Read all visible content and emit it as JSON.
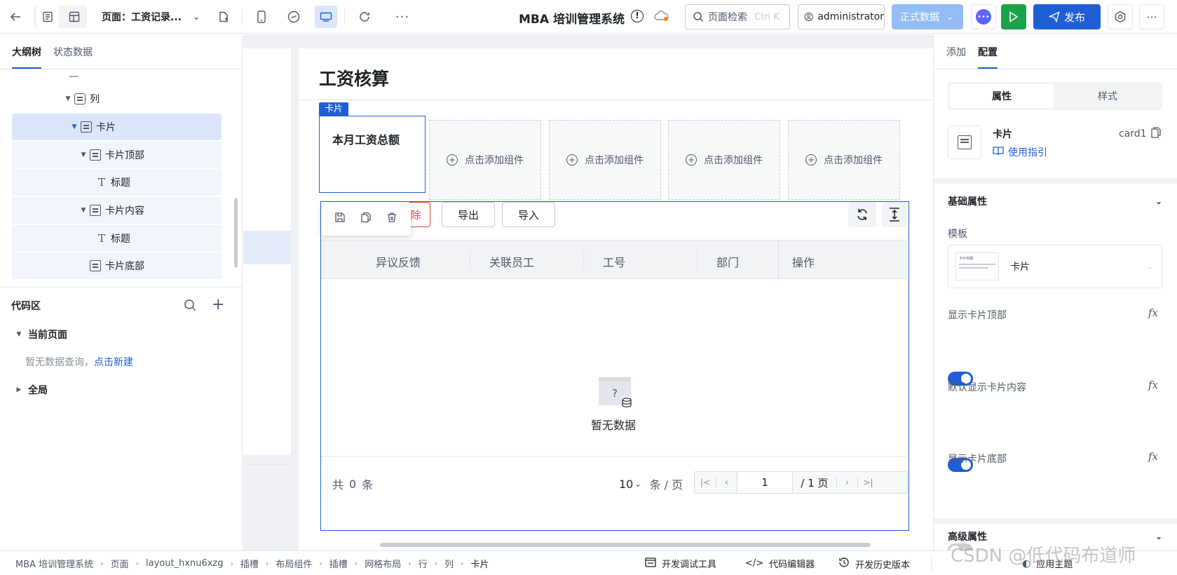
{
  "topbar": {
    "page_label": "页面：工资记录...",
    "app_title": "MBA 培训管理系统",
    "search_placeholder": "页面检索",
    "search_shortcut": "Ctrl K",
    "user": "administrator",
    "env_label": "正式数据",
    "publish_label": "发布"
  },
  "left": {
    "tabs": [
      "大纲树",
      "状态数据"
    ],
    "tree": {
      "dash": "—",
      "col": "列",
      "card": "卡片",
      "card_top": "卡片顶部",
      "title1": "标题",
      "card_content": "卡片内容",
      "title2": "标题",
      "card_bottom": "卡片底部"
    },
    "code": {
      "header": "代码区",
      "current_page": "当前页面",
      "empty_prefix": "暂无数据查询，",
      "empty_link": "点击新建",
      "global": "全局"
    }
  },
  "canvas": {
    "page_title": "工资核算",
    "card_tag": "卡片",
    "card_title": "本月工资总额",
    "add_slot_label": "点击添加组件",
    "toolbar": {
      "delete_partial": "除",
      "export": "导出",
      "import": "导入"
    },
    "table": {
      "columns": [
        "异议反馈",
        "关联员工",
        "工号",
        "部门",
        "操作"
      ],
      "empty_text": "暂无数据",
      "empty_icon_glyph": "?"
    },
    "pagination": {
      "total_prefix": "共",
      "total_count": "0",
      "total_suffix": "条",
      "page_size": "10",
      "per_page": "条 / 页",
      "current_page": "1",
      "total_pages": "/ 1 页"
    }
  },
  "right": {
    "tabs": [
      "添加",
      "配置"
    ],
    "segment": [
      "属性",
      "样式"
    ],
    "component_name": "卡片",
    "component_id": "card1",
    "guide_link": "使用指引",
    "basic_props": "基础属性",
    "template_label": "模板",
    "template_value": "卡片",
    "template_thumb_title": "卡片标题",
    "show_top": "显示卡片顶部",
    "show_content": "默认显示卡片内容",
    "show_bottom": "显示卡片底部",
    "advanced_props": "高级属性",
    "switches": {
      "show_top": true,
      "show_content": true,
      "show_bottom": false
    }
  },
  "bottom": {
    "breadcrumbs": [
      "MBA 培训管理系统",
      "页面",
      "layout_hxnu6xzg",
      "插槽",
      "布局组件",
      "插槽",
      "网格布局",
      "行",
      "列",
      "卡片"
    ],
    "dev_tools": "开发调试工具",
    "code_editor": "代码编辑器",
    "history": "开发历史版本",
    "theme": "应用主题",
    "watermark": "CSDN @低代码布道师"
  },
  "colors": {
    "primary": "#1f5fd6",
    "selected_bg": "#dbe6fb",
    "green": "#1aa34a",
    "danger": "#f53f3f",
    "env_bg": "#94bdf5"
  }
}
